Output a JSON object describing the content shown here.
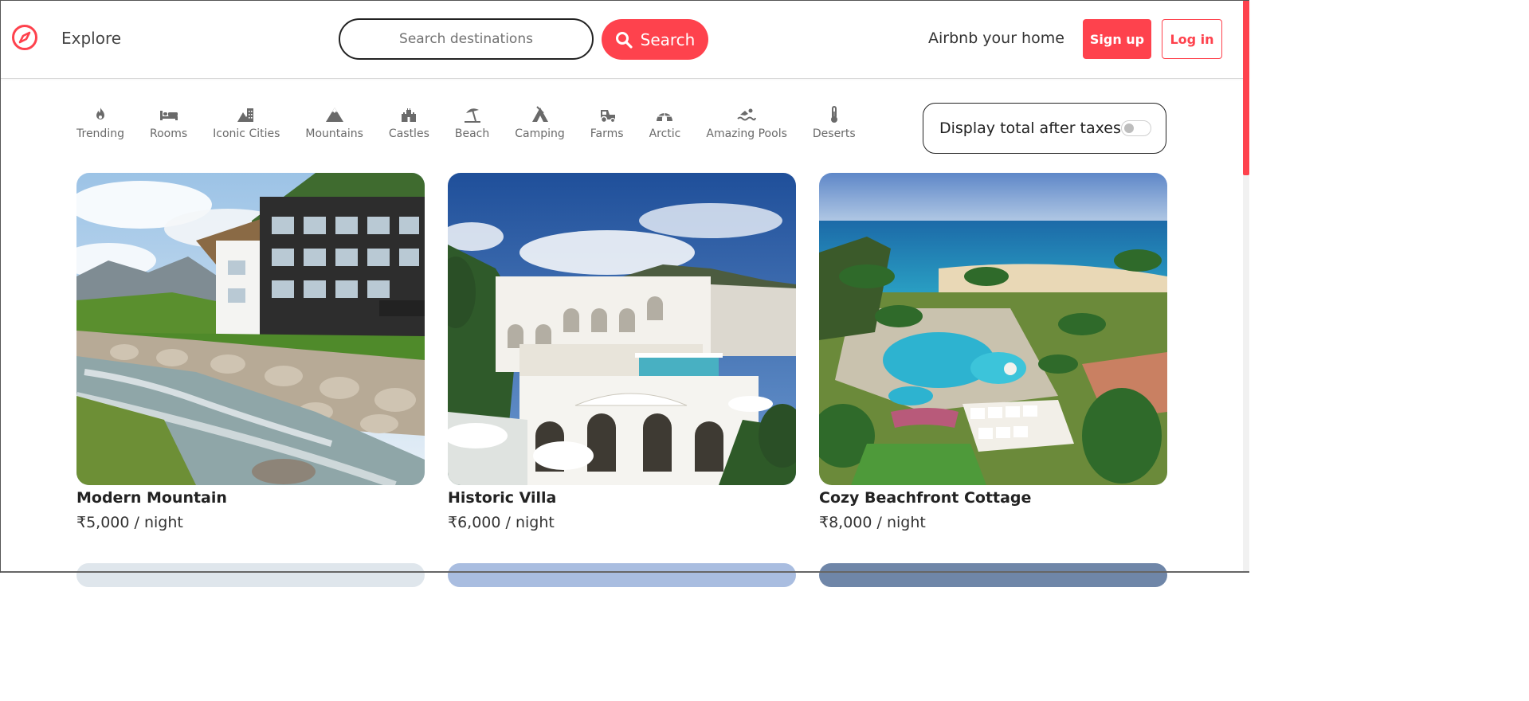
{
  "nav": {
    "logo_icon": "compass-icon",
    "explore_label": "Explore",
    "search_placeholder": "Search destinations",
    "search_value": "",
    "search_button_label": "Search",
    "host_label": "Airbnb your home",
    "signup_label": "Sign up",
    "login_label": "Log in"
  },
  "filters": [
    {
      "label": "Trending",
      "icon": "fire-icon"
    },
    {
      "label": "Rooms",
      "icon": "bed-icon"
    },
    {
      "label": "Iconic Cities",
      "icon": "city-icon"
    },
    {
      "label": "Mountains",
      "icon": "mountain-icon"
    },
    {
      "label": "Castles",
      "icon": "castle-icon"
    },
    {
      "label": "Beach",
      "icon": "umbrella-beach-icon"
    },
    {
      "label": "Camping",
      "icon": "campground-icon"
    },
    {
      "label": "Farms",
      "icon": "tractor-icon"
    },
    {
      "label": "Arctic",
      "icon": "igloo-icon"
    },
    {
      "label": "Amazing Pools",
      "icon": "swimmer-icon"
    },
    {
      "label": "Deserts",
      "icon": "thermometer-icon"
    }
  ],
  "tax_toggle": {
    "label": "Display total after taxes",
    "enabled": false
  },
  "listings": [
    {
      "title": "Modern Mountain",
      "price": "₹5,000 / night"
    },
    {
      "title": "Historic Villa",
      "price": "₹6,000 / night"
    },
    {
      "title": "Cozy Beachfront Cottage",
      "price": "₹8,000 / night"
    }
  ],
  "colors": {
    "brand": "#fe424d",
    "text": "#222222",
    "muted": "#6a6a6a"
  }
}
